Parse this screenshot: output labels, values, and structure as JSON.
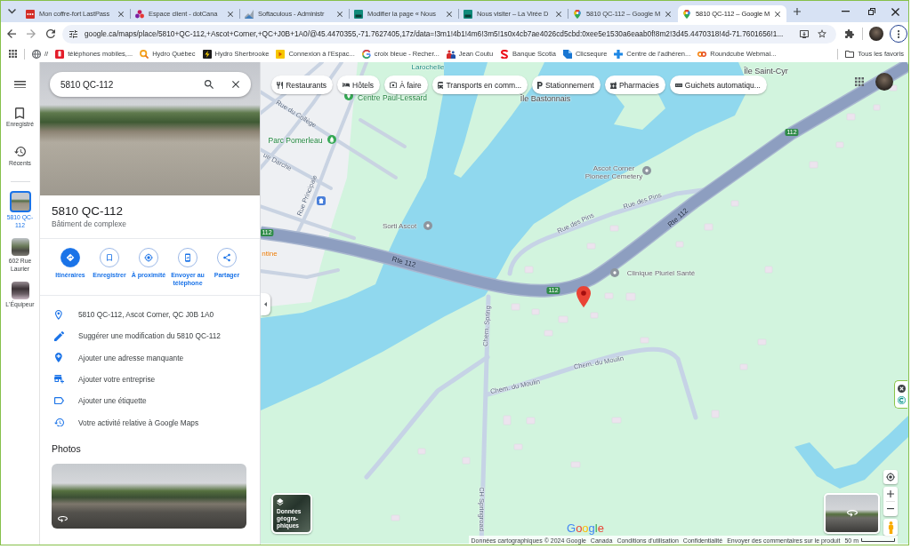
{
  "browser": {
    "tabs": [
      {
        "title": "Mon coffre-fort LastPass",
        "kind": "lastpass",
        "selected": false
      },
      {
        "title": "Espace client - dotCana",
        "kind": "dotca",
        "selected": false
      },
      {
        "title": "Softaculous - Administr",
        "kind": "softaculous",
        "selected": false
      },
      {
        "title": "Modifier la page « Nous",
        "kind": "site",
        "selected": false
      },
      {
        "title": "Nous visiter – La Virée D",
        "kind": "site",
        "selected": false
      },
      {
        "title": "5810 QC-112 – Google M",
        "kind": "maps",
        "selected": false
      },
      {
        "title": "5810 QC-112 – Google M",
        "kind": "maps",
        "selected": true
      }
    ],
    "address": "google.ca/maps/place/5810+QC-112,+Ascot+Corner,+QC+J0B+1A0/@45.4470355,-71.7627405,17z/data=!3m1!4b1!4m6!3m5!1s0x4cb7ae4026cd5cbd:0xee5e1530a6eaab0f!8m2!3d45.4470318!4d-71.7601656!1...",
    "bookmarks": [
      {
        "label": "//",
        "kind": "globe"
      },
      {
        "label": "téléphones mobiles,...",
        "kind": "phone"
      },
      {
        "label": "Hydro Québec",
        "kind": "magnifier"
      },
      {
        "label": "Hydro Sherbrooke",
        "kind": "bolt"
      },
      {
        "label": "Connexion à l'Espac...",
        "kind": "arrow"
      },
      {
        "label": "croix bleue - Recher...",
        "kind": "gsearch"
      },
      {
        "label": "Jean Coutu",
        "kind": "people"
      },
      {
        "label": "Banque Scotia",
        "kind": "swirl"
      },
      {
        "label": "Clicsequre",
        "kind": "fold"
      },
      {
        "label": "Centre de l'adhéren...",
        "kind": "cross"
      },
      {
        "label": "Roundcube Webmai...",
        "kind": "rings"
      }
    ],
    "all_bookmarks": "Tous les favoris"
  },
  "rail": {
    "items": [
      {
        "label": "Enregistré",
        "kind": "saved"
      },
      {
        "label": "Récents",
        "kind": "recent"
      }
    ],
    "places": [
      {
        "label": "5810 QC-112",
        "selected": true
      },
      {
        "label": "602 Rue Laurier",
        "selected": false
      },
      {
        "label": "L'Équipeur",
        "selected": false
      }
    ]
  },
  "panel": {
    "search": {
      "value": "5810 QC-112"
    },
    "title": "5810 QC-112",
    "subtitle": "Bâtiment de complexe",
    "actions": [
      {
        "label": "Itinéraires",
        "kind": "directions",
        "primary": true
      },
      {
        "label": "Enregistrer",
        "kind": "save",
        "primary": false
      },
      {
        "label": "À proximité",
        "kind": "nearby",
        "primary": false
      },
      {
        "label": "Envoyer au téléphone",
        "kind": "send",
        "primary": false
      },
      {
        "label": "Partager",
        "kind": "share",
        "primary": false
      }
    ],
    "details": [
      {
        "text": "5810 QC-112, Ascot Corner, QC J0B 1A0",
        "kind": "address"
      },
      {
        "text": "Suggérer une modification du 5810 QC-112",
        "kind": "edit"
      },
      {
        "text": "Ajouter une adresse manquante",
        "kind": "add_place"
      },
      {
        "text": "Ajouter votre entreprise",
        "kind": "add_business"
      },
      {
        "text": "Ajouter une étiquette",
        "kind": "label"
      },
      {
        "text": "Votre activité relative à Google Maps",
        "kind": "history"
      }
    ],
    "photos_heading": "Photos"
  },
  "map": {
    "chips": [
      {
        "label": "Restaurants",
        "kind": "restaurants"
      },
      {
        "label": "Hôtels",
        "kind": "hotels"
      },
      {
        "label": "À faire",
        "kind": "things"
      },
      {
        "label": "Transports en comm...",
        "kind": "transit"
      },
      {
        "label": "Stationnement",
        "kind": "parking"
      },
      {
        "label": "Pharmacies",
        "kind": "pharmacy"
      },
      {
        "label": "Guichets automatiqu...",
        "kind": "atm"
      }
    ],
    "labels": [
      {
        "text": "Larochelle",
        "kind": "district"
      },
      {
        "text": "Île Saint-Cyr",
        "kind": "island"
      },
      {
        "text": "Centre Paul-Lessard",
        "kind": "recreation"
      },
      {
        "text": "Île Bastonnais",
        "kind": "island"
      },
      {
        "text": "Rue du Collège",
        "kind": "street"
      },
      {
        "text": "Parc Pomerleau",
        "kind": "park"
      },
      {
        "text": "ue Darche",
        "kind": "street"
      },
      {
        "text": "Rue Principale",
        "kind": "street"
      },
      {
        "text": "Ascot Corner Pioneer Cemetery",
        "kind": "poi"
      },
      {
        "text": "Rue des Pins",
        "kind": "street"
      },
      {
        "text": "Rue des Pins",
        "kind": "street"
      },
      {
        "text": "Rte 112",
        "kind": "route"
      },
      {
        "text": "Sorti Ascot",
        "kind": "poi"
      },
      {
        "text": "ntine",
        "kind": "business"
      },
      {
        "text": "Rte 112",
        "kind": "route"
      },
      {
        "text": "Clinique Pluriel Santé",
        "kind": "poi"
      },
      {
        "text": "Chem. Spring",
        "kind": "street"
      },
      {
        "text": "Chem. du Moulin",
        "kind": "street"
      },
      {
        "text": "Chem. du Moulin",
        "kind": "street"
      },
      {
        "text": "CH Springroad",
        "kind": "street"
      }
    ],
    "shields": [
      "112",
      "112",
      "112"
    ],
    "layers_button": "Données géogra-phiques",
    "logo": "Google",
    "attribution": [
      "Données cartographiques © 2024 Google",
      "Canada",
      "Conditions d'utilisation",
      "Confidentialité",
      "Envoyer des commentaires sur le produit"
    ],
    "scale": "50 m"
  }
}
